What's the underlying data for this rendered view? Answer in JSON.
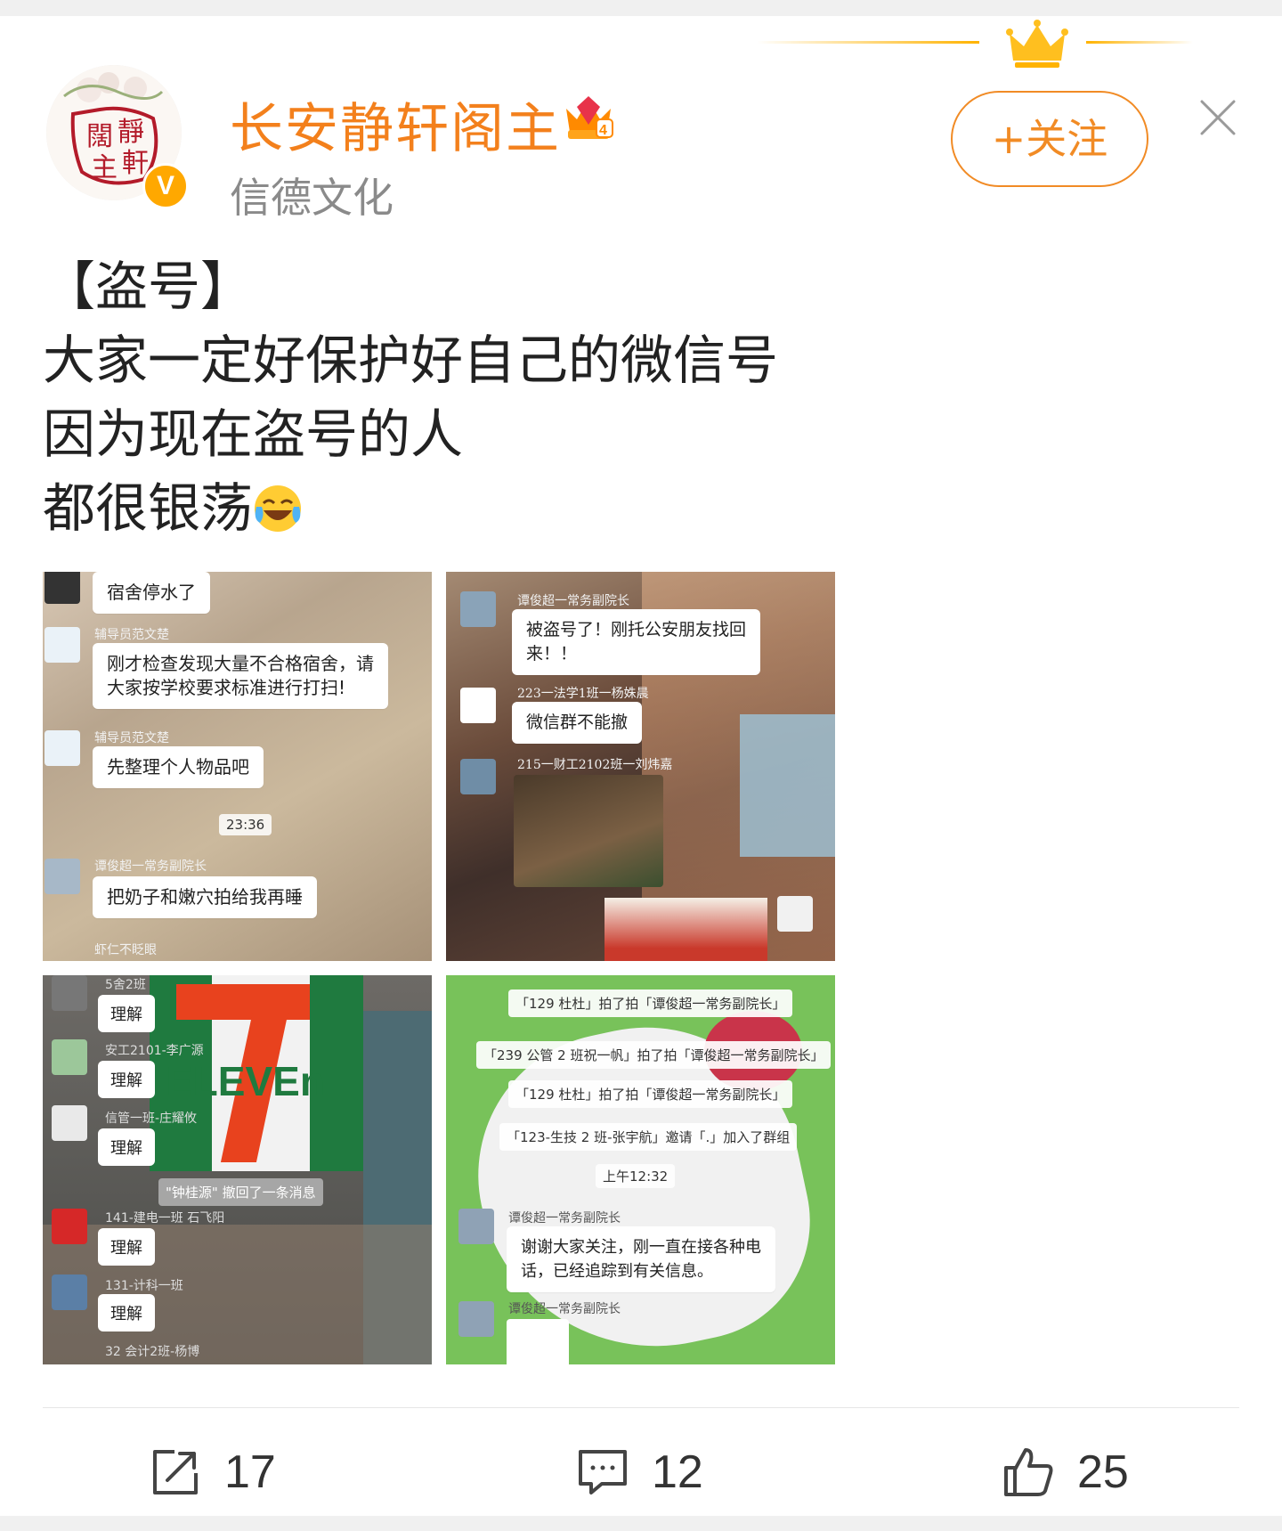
{
  "user": {
    "name": "长安静轩阁主",
    "subtitle": "信德文化",
    "vip_level": "4",
    "verified_mark": "V"
  },
  "follow_button": {
    "plus": "+",
    "label": "关注"
  },
  "post": {
    "lines": [
      "【盗号】",
      "大家一定好保护好自己的微信号",
      "因为现在盗号的人",
      "都很银荡"
    ],
    "emoji": "laugh-cry-emoji"
  },
  "images": {
    "img1": {
      "top_bubble": "宿舍停水了",
      "name1": "辅导员范文楚",
      "bubble1_line1": "刚才检查发现大量不合格宿舍，请",
      "bubble1_line2": "大家按学校要求标准进行打扫!",
      "name2": "辅导员范文楚",
      "bubble2": "先整理个人物品吧",
      "time": "23:36",
      "name3": "谭俊超一常务副院长",
      "bubble3": "把奶子和嫩穴拍给我再睡",
      "name4": "虾仁不眨眼"
    },
    "img2": {
      "name1": "谭俊超一常务副院长",
      "bubble1_line1": "被盗号了！刚托公安朋友找回",
      "bubble1_line2": "来！！",
      "name2": "223一法学1班一杨姝晨",
      "bubble2": "微信群不能撤",
      "name3": "215一财工2102班一刘炜嘉"
    },
    "img3": {
      "reply": "理解",
      "name1": "5舍2班",
      "name2": "安工2101-李广源",
      "name3": "信管一班-庄耀攸",
      "notice": "\"钟桂源\" 撤回了一条消息",
      "name4": "141-建电一班 石飞阳",
      "name5": "131-计科一班",
      "name6": "32 会计2班-杨博",
      "sign_text": "ELEVEn"
    },
    "img4": {
      "sys1": "「129 杜杜」拍了拍「谭俊超一常务副院长」",
      "sys2": "「239 公管 2 班祝一帆」拍了拍「谭俊超一常务副院长」",
      "sys3": "「129 杜杜」拍了拍「谭俊超一常务副院长」",
      "sys4": "「123-生技 2 班-张宇航」邀请「.」加入了群组",
      "time": "上午12:32",
      "name1": "谭俊超一常务副院长",
      "bubble_line1": "谢谢大家关注，刚一直在接各种电",
      "bubble_line2": "话，已经追踪到有关信息。",
      "name2": "谭俊超一常务副院长"
    }
  },
  "actions": {
    "repost_count": "17",
    "comment_count": "12",
    "like_count": "25"
  },
  "colors": {
    "username": "#f3801c",
    "follow": "#f18b25",
    "badge": "#ffa800"
  }
}
